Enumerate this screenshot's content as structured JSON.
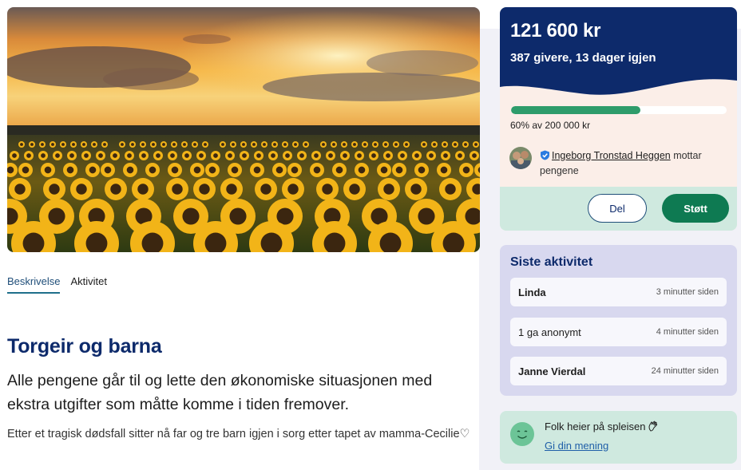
{
  "tabs": [
    {
      "label": "Beskrivelse",
      "active": true
    },
    {
      "label": "Aktivitet",
      "active": false
    }
  ],
  "content": {
    "title": "Torgeir og barna",
    "lead": "Alle pengene går til og lette den økonomiske situasjonen med ekstra utgifter som måtte komme i tiden fremover.",
    "body": "Etter et tragisk dødsfall sitter nå far og tre barn igjen i sorg etter tapet av mamma-Cecilie♡"
  },
  "campaign": {
    "amount": "121 600 kr",
    "givers_line": "387 givere, 13 dager igjen",
    "progress_fraction": 0.6,
    "progress_text": "60% av 200 000 kr",
    "recipient_name": "Ingeborg Tronstad Heggen",
    "recipient_suffix": " mottar pengene",
    "share_label": "Del",
    "support_label": "Støtt"
  },
  "activity": {
    "title": "Siste aktivitet",
    "items": [
      {
        "name": "Linda",
        "time": "3 minutter siden",
        "bold": true
      },
      {
        "name": "1 ga anonymt",
        "time": "4 minutter siden",
        "bold": false
      },
      {
        "name": "Janne Vierdal",
        "time": "24 minutter siden",
        "bold": true
      }
    ]
  },
  "cheer": {
    "text": "Folk heier på spleisen",
    "link": "Gi din mening"
  },
  "icons": {
    "verified": "verified-badge-icon",
    "smile": "smile-face-icon",
    "hand": "clapping-hand-icon"
  },
  "colors": {
    "brand_navy": "#0d2a6b",
    "progress_green": "#2e9c6b",
    "support_green": "#0e7a52",
    "mint": "#cfe9df",
    "lavender": "#d8d8ef"
  }
}
